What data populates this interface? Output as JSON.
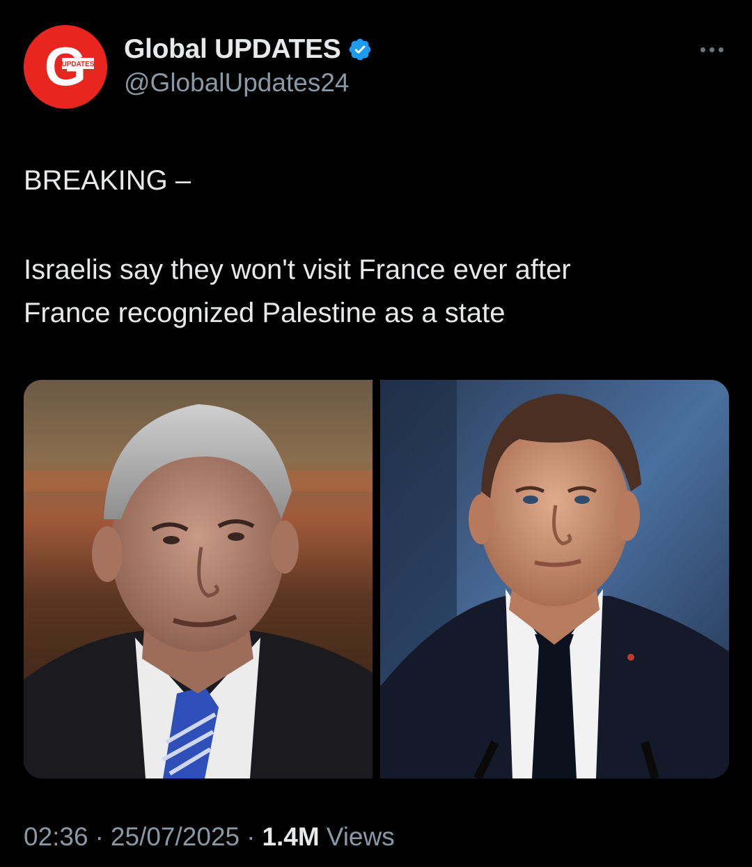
{
  "account": {
    "avatar_letter": "G",
    "avatar_badge": "UPDATES",
    "display_name": "Global UPDATES",
    "handle": "@GlobalUpdates24",
    "verified": true
  },
  "tweet": {
    "heading": "BREAKING –",
    "body_line_1": "Israelis say they won't visit France ever after",
    "body_line_2": "France recognized Palestine as a state"
  },
  "media": {
    "count": 2,
    "icons": [
      "portrait-photo-left",
      "portrait-photo-right"
    ]
  },
  "footer": {
    "time": "02:36",
    "separator": "·",
    "date": "25/07/2025",
    "views_count": "1.4M",
    "views_label": "Views"
  },
  "colors": {
    "background": "#000000",
    "text_primary": "#e7e9ea",
    "text_secondary": "#8b98a5",
    "verified_blue": "#1d9bf0",
    "avatar_red": "#e8261f"
  }
}
